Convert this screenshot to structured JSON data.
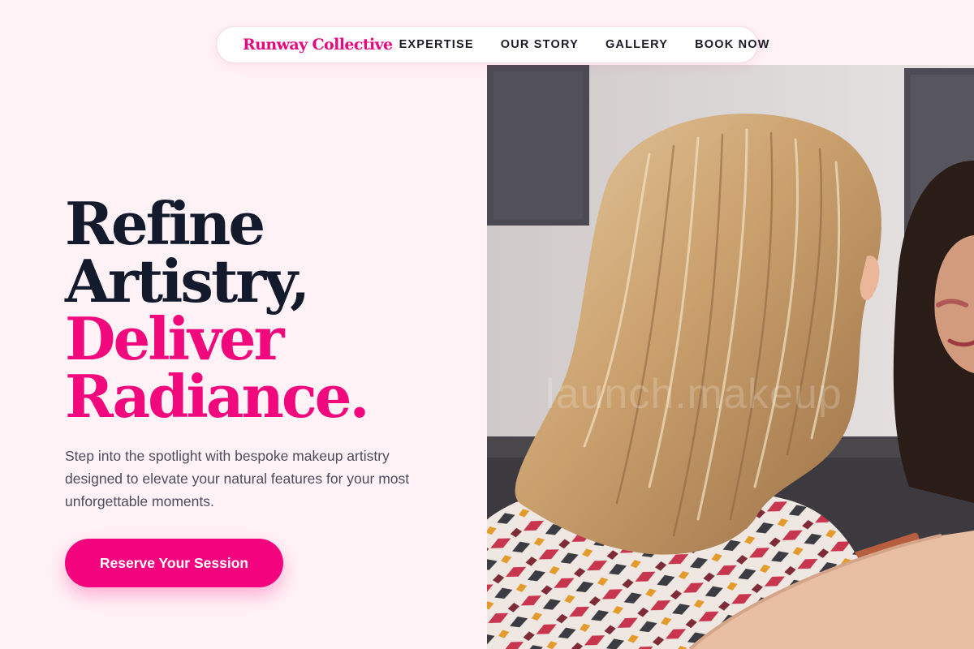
{
  "nav": {
    "brand": "Runway Collective",
    "links": [
      "EXPERTISE",
      "OUR STORY",
      "GALLERY",
      "BOOK NOW"
    ]
  },
  "hero": {
    "headline": {
      "line1": "Refine",
      "line2": "Artistry,",
      "line3": "Deliver",
      "line4": "Radiance."
    },
    "subtext": "Step into the spotlight with bespoke makeup artistry designed to elevate your natural features for your most unforgettable moments.",
    "cta_label": "Reserve Your Session",
    "image": {
      "subject": "makeup artist with blonde hair applying makeup to a client",
      "watermark": "launch.makeup"
    }
  },
  "colors": {
    "background": "#fff2f6",
    "accent": "#f4037f",
    "heading_dark": "#131a2c",
    "body_text": "#4c4c5c"
  }
}
